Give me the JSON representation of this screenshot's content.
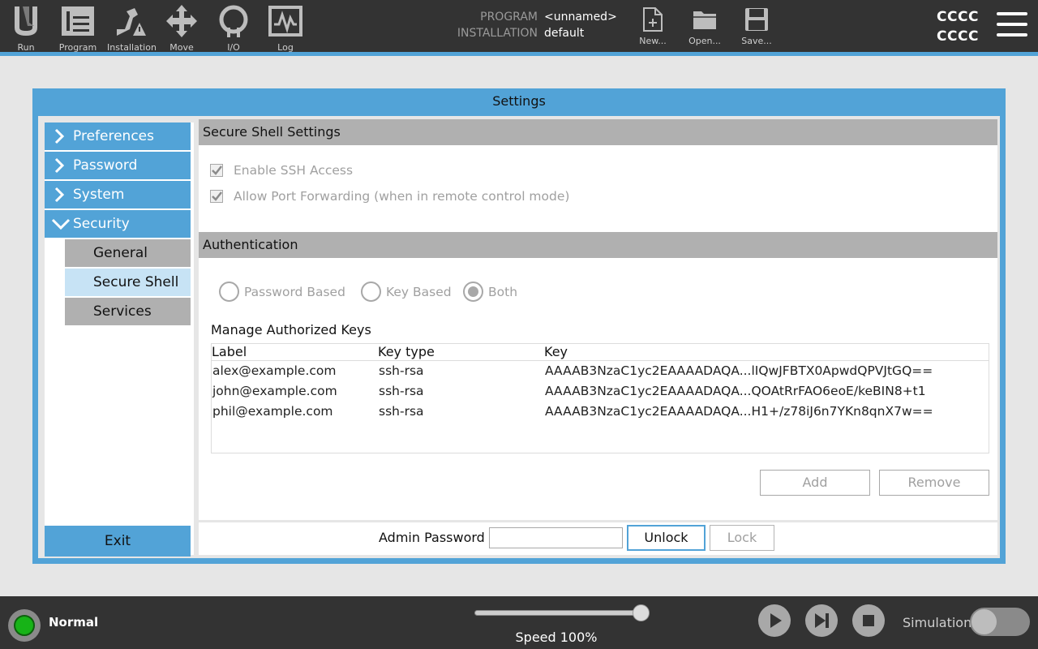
{
  "topbar": {
    "nav": [
      {
        "id": "run",
        "label": "Run",
        "icon": "ur-logo-icon"
      },
      {
        "id": "program",
        "label": "Program",
        "icon": "program-icon"
      },
      {
        "id": "installation",
        "label": "Installation",
        "icon": "installation-icon"
      },
      {
        "id": "move",
        "label": "Move",
        "icon": "move-arrows-icon"
      },
      {
        "id": "io",
        "label": "I/O",
        "icon": "io-icon"
      },
      {
        "id": "log",
        "label": "Log",
        "icon": "log-icon"
      }
    ],
    "program_key": "PROGRAM",
    "program_value": "<unnamed>",
    "installation_key": "INSTALLATION",
    "installation_value": "default",
    "file_actions": [
      {
        "id": "new",
        "label": "New...",
        "icon": "new-file-icon"
      },
      {
        "id": "open",
        "label": "Open...",
        "icon": "open-folder-icon"
      },
      {
        "id": "save",
        "label": "Save...",
        "icon": "save-disk-icon"
      }
    ],
    "robot_id_line1": "CCCC",
    "robot_id_line2": "CCCC",
    "menu_icon": "hamburger-menu-icon"
  },
  "dialog": {
    "title": "Settings",
    "sidebar": {
      "items": [
        {
          "label": "Preferences",
          "expanded": false
        },
        {
          "label": "Password",
          "expanded": false
        },
        {
          "label": "System",
          "expanded": false
        },
        {
          "label": "Security",
          "expanded": true
        }
      ],
      "sub_items": [
        {
          "label": "General",
          "active": false
        },
        {
          "label": "Secure Shell",
          "active": true
        },
        {
          "label": "Services",
          "active": false
        }
      ],
      "exit_label": "Exit"
    },
    "ssh": {
      "section_title": "Secure Shell Settings",
      "enable_ssh_label": "Enable SSH Access",
      "enable_ssh_checked": true,
      "port_forwarding_label": "Allow Port Forwarding (when in remote control mode)",
      "port_forwarding_checked": true
    },
    "auth": {
      "section_title": "Authentication",
      "options": [
        "Password Based",
        "Key Based",
        "Both"
      ],
      "selected": "Both",
      "manage_keys_label": "Manage Authorized Keys",
      "columns": [
        "Label",
        "Key type",
        "Key"
      ],
      "rows": [
        {
          "label": "alex@example.com",
          "type": "ssh-rsa",
          "key": "AAAAB3NzaC1yc2EAAAADAQA...lIQwJFBTX0ApwdQPVJtGQ=="
        },
        {
          "label": "john@example.com",
          "type": "ssh-rsa",
          "key": "AAAAB3NzaC1yc2EAAAADAQA...QOAtRrFAO6eoE/keBIN8+t1"
        },
        {
          "label": "phil@example.com",
          "type": "ssh-rsa",
          "key": "AAAAB3NzaC1yc2EAAAADAQA...H1+/z78iJ6n7YKn8qnX7w=="
        }
      ],
      "add_label": "Add",
      "remove_label": "Remove"
    },
    "admin": {
      "password_label": "Admin Password",
      "password_value": "",
      "unlock_label": "Unlock",
      "lock_label": "Lock"
    }
  },
  "footer": {
    "status": "Normal",
    "speed_label": "Speed 100%",
    "speed_fraction": 1.0,
    "simulation_label": "Simulation",
    "simulation_on": false
  },
  "colors": {
    "accent": "#52a3d7",
    "topbar": "#333333",
    "section_header": "#b0b0b0",
    "active_sub": "#c7e3f5",
    "status_ok": "#17b317"
  }
}
